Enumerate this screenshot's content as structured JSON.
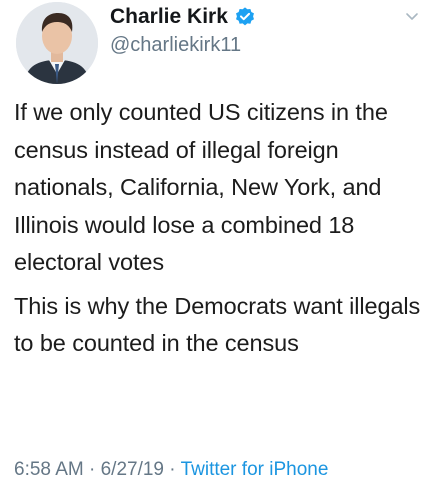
{
  "author": {
    "display_name": "Charlie Kirk",
    "handle": "@charliekirk11",
    "verified": true
  },
  "tweet": {
    "paragraphs": [
      "If we only counted US citizens in the census instead of illegal foreign nationals, California, New York, and Illinois would lose a combined 18 electoral votes",
      "This is why the Democrats want illegals to be counted in the census"
    ],
    "time": "6:58 AM",
    "separator": " · ",
    "date": "6/27/19",
    "source": "Twitter for iPhone"
  },
  "icons": {
    "verified": "verified-badge-icon",
    "menu": "chevron-down-icon"
  },
  "colors": {
    "text": "#1c1c1c",
    "secondary": "#657786",
    "link": "#1b95e0",
    "verified": "#1da1f2"
  }
}
